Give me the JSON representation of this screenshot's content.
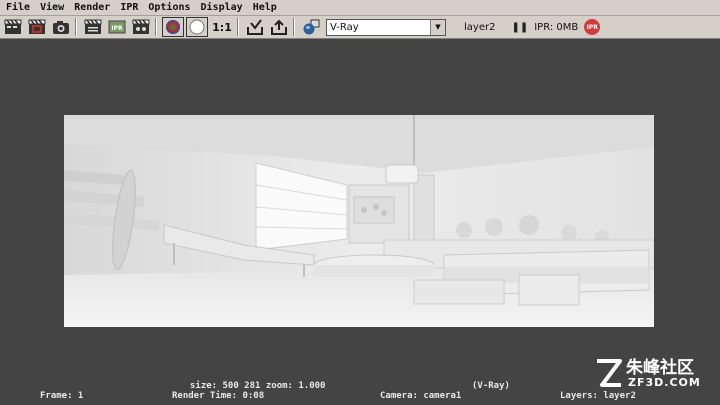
{
  "menu": [
    "File",
    "View",
    "Render",
    "IPR",
    "Options",
    "Display",
    "Help"
  ],
  "toolbar": {
    "icons": [
      "redo-render-icon",
      "render-region-icon",
      "snapshot-icon",
      "batch-render-icon",
      "ipr-render-icon",
      "ipr-refresh-icon",
      "rgb-channel-icon",
      "alpha-channel-icon",
      "keep-image-icon",
      "remove-image-icon",
      "render-settings-icon"
    ],
    "ratio_label": "1:1",
    "renderer": "V-Ray",
    "layer": "layer2",
    "ipr_memory": "IPR: 0MB",
    "ipr_badge": "IPR"
  },
  "status": {
    "size_line": "size:  500  281 zoom: 1.000",
    "renderer_tag": "(V-Ray)",
    "frame": "Frame: 1",
    "render_time": "Render Time: 0:08",
    "camera": "Camera: camera1",
    "layers": "Layers: layer2"
  },
  "watermark": {
    "title": "朱峰社区",
    "site": "ZF3D.COM"
  }
}
